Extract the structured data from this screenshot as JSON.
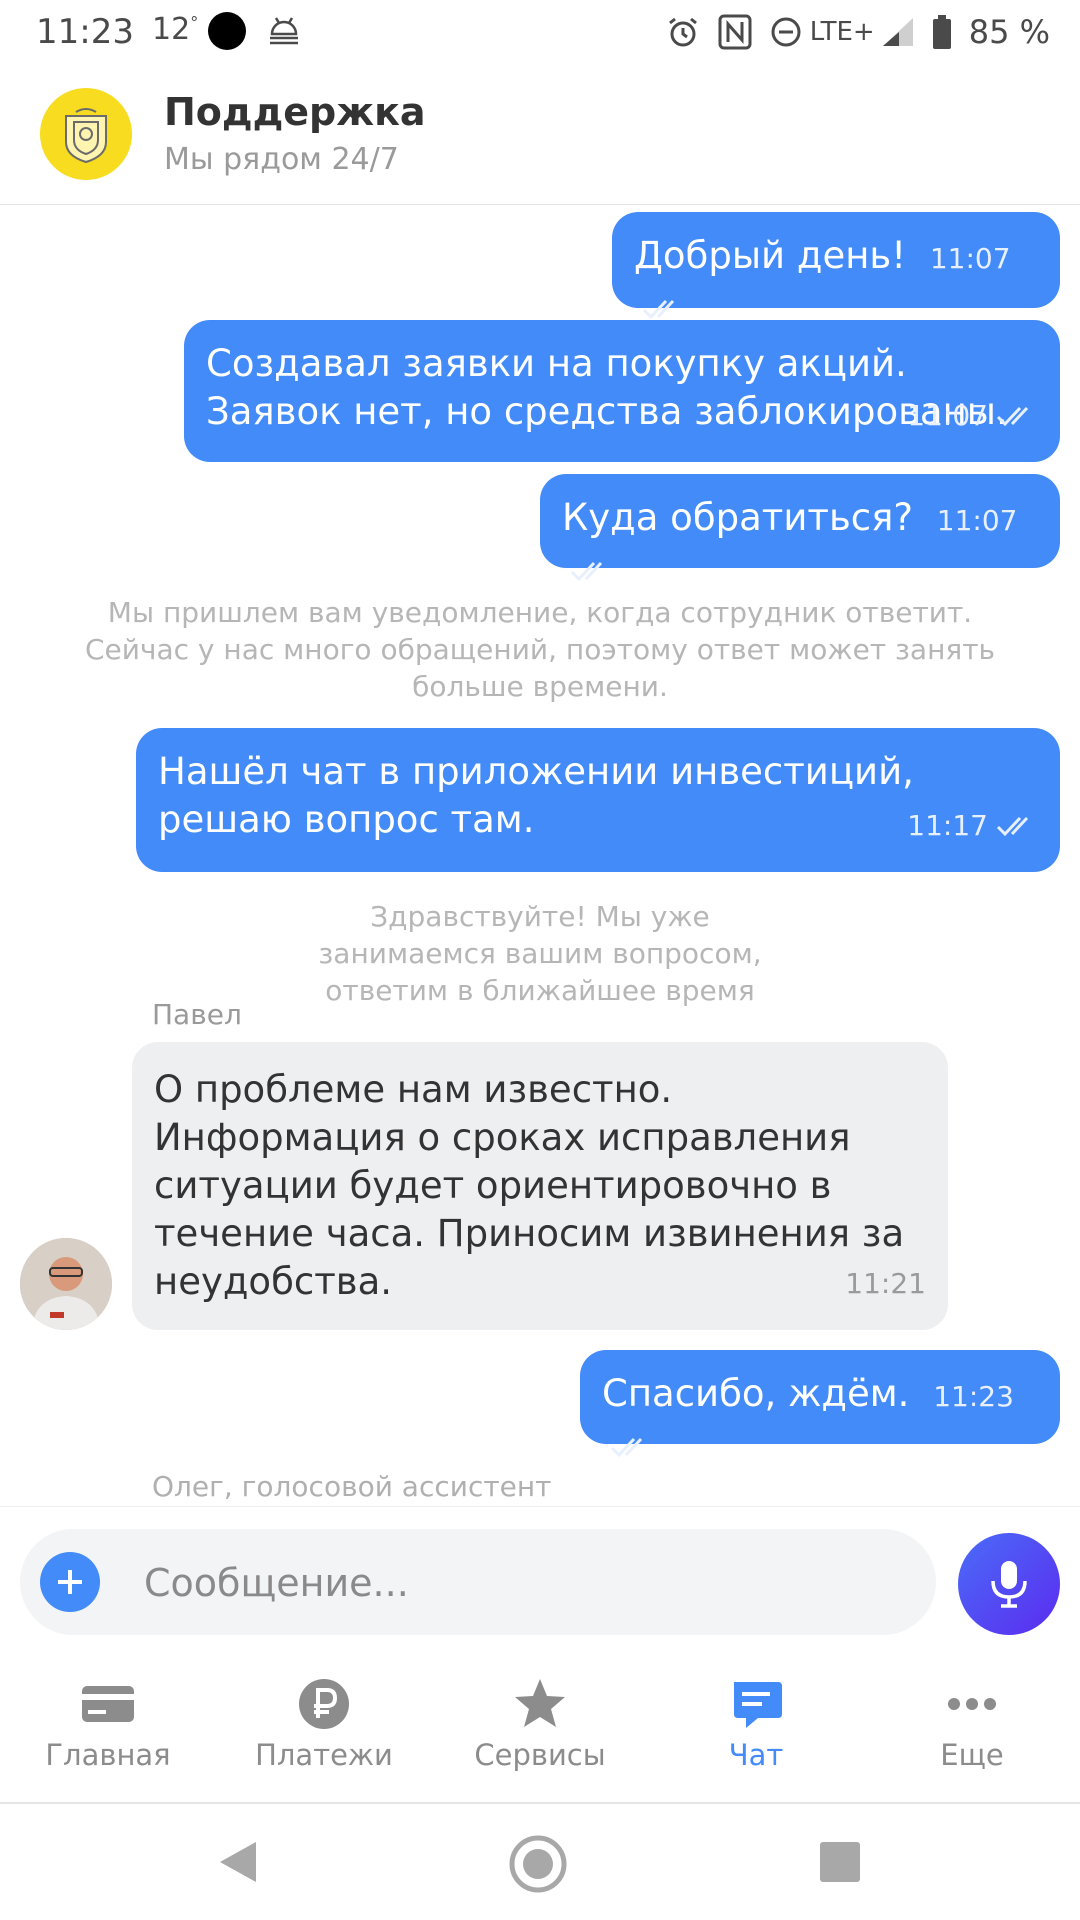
{
  "status_bar": {
    "time": "11:23",
    "temperature": "12",
    "network": "LTE+",
    "battery": "85 %",
    "icons": [
      "alarm-icon",
      "nfc-icon",
      "dnd-icon",
      "signal-icon",
      "battery-icon"
    ]
  },
  "header": {
    "title": "Поддержка",
    "subtitle": "Мы рядом 24/7"
  },
  "chat": {
    "messages_out": [
      {
        "text": "Добрый день!",
        "time": "11:07"
      },
      {
        "text": "Создавал заявки на покупку акций. Заявок нет, но средства заблокированы.",
        "time": "11:07"
      },
      {
        "text": "Куда обратиться?",
        "time": "11:07"
      },
      {
        "text": "Нашёл чат в приложении инвестиций, решаю вопрос там.",
        "time": "11:17"
      },
      {
        "text": "Спасибо, ждём.",
        "time": "11:23"
      }
    ],
    "system_notes": [
      "Мы пришлем вам уведомление, когда сотрудник ответит. Сейчас у нас много обращений, поэтому ответ может занять больше времени.",
      "Здравствуйте! Мы уже занимаемся вашим вопросом, ответим в ближайшее время"
    ],
    "incoming": {
      "sender": "Павел",
      "text": "О проблеме нам известно. Информация о сроках исправления ситуации будет ориентировочно в течение часа. Приносим извинения за неудобства.",
      "time": "11:21"
    },
    "next_sender": "Олег, голосовой ассистент"
  },
  "input": {
    "placeholder": "Сообщение..."
  },
  "nav": {
    "items": [
      {
        "label": "Главная",
        "icon": "card-icon"
      },
      {
        "label": "Платежи",
        "icon": "ruble-icon"
      },
      {
        "label": "Сервисы",
        "icon": "star-icon"
      },
      {
        "label": "Чат",
        "icon": "chat-icon"
      },
      {
        "label": "Еще",
        "icon": "more-icon"
      }
    ],
    "active": "Чат"
  },
  "colors": {
    "accent": "#428bf9",
    "bubble_in": "#eeeff1",
    "logo_yellow": "#f7dc1f",
    "system_text": "#b6b6b6"
  }
}
